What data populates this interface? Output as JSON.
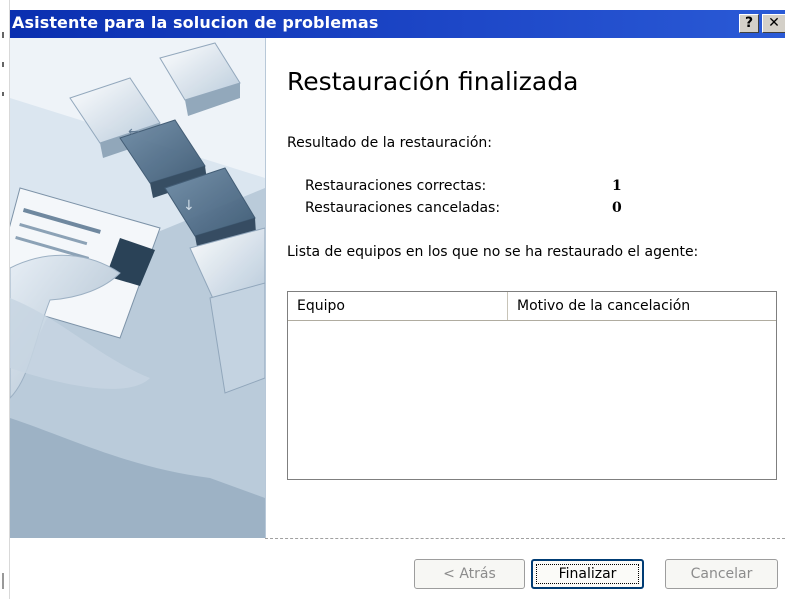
{
  "window": {
    "title": "Asistente para la solucion de problemas",
    "help_button": "?",
    "close_button": "✕"
  },
  "page": {
    "heading": "Restauración finalizada",
    "result_label": "Resultado de la restauración:",
    "stats": [
      {
        "label": "Restauraciones correctas:",
        "value": "1"
      },
      {
        "label": "Restauraciones canceladas:",
        "value": "0"
      }
    ],
    "list_label": "Lista de equipos en los que no se ha restaurado el agente:",
    "table": {
      "columns": [
        "Equipo",
        "Motivo de la cancelación"
      ],
      "rows": []
    }
  },
  "buttons": {
    "back": "< Atrás",
    "finish": "Finalizar",
    "cancel": "Cancelar"
  },
  "colors": {
    "titlebar": "#0a2fb0",
    "default_button_border": "#003c74",
    "disabled_text": "#8c8c8c"
  }
}
